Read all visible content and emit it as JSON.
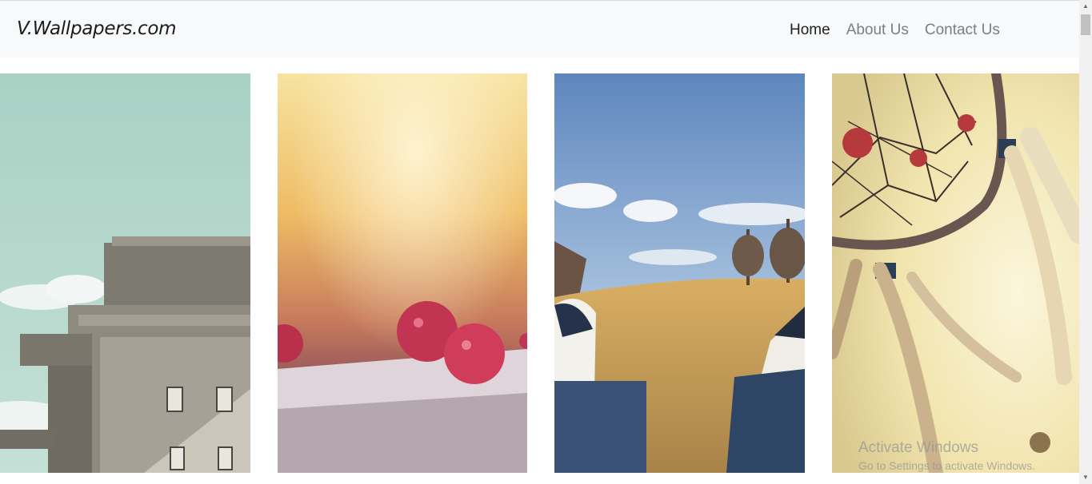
{
  "navbar": {
    "brand": "V.Wallpapers.com",
    "links": [
      {
        "label": "Home",
        "active": true
      },
      {
        "label": "About Us",
        "active": false
      },
      {
        "label": "Contact Us",
        "active": false
      }
    ]
  },
  "gallery": {
    "images": [
      {
        "subject": "concrete-tower-sky"
      },
      {
        "subject": "raspberries-on-table"
      },
      {
        "subject": "sneakers-in-field"
      },
      {
        "subject": "dreamcatcher-sunlight"
      }
    ]
  },
  "watermark": {
    "title": "Activate Windows",
    "subtitle": "Go to Settings to activate Windows."
  },
  "scrollbar": {
    "up_glyph": "▲",
    "down_glyph": "▼"
  },
  "colors": {
    "navbar_bg": "#f8f9fa",
    "active_link": "#1f1f1f",
    "link": "#7b7e82"
  }
}
